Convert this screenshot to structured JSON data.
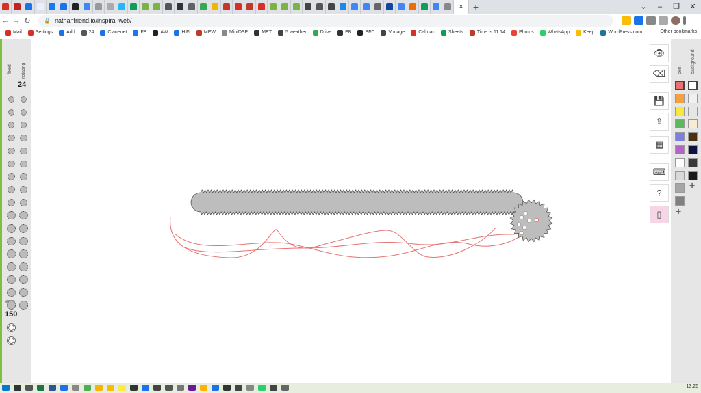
{
  "browser": {
    "url": "nathanfriend.io/inspiral-web/",
    "tab_count": 48,
    "close_label": "×",
    "new_tab_label": "+",
    "window_controls": [
      "⌄",
      "–",
      "❐",
      "✕"
    ],
    "bookmarks": [
      {
        "label": "Mail",
        "color": "#d93025"
      },
      {
        "label": "Settings",
        "color": "#d93025"
      },
      {
        "label": "Add",
        "color": "#1a73e8"
      },
      {
        "label": "24",
        "color": "#555555"
      },
      {
        "label": "Clanenet",
        "color": "#1a73e8"
      },
      {
        "label": "FB",
        "color": "#1877f2"
      },
      {
        "label": "AW",
        "color": "#222222"
      },
      {
        "label": "HiFi",
        "color": "#1a73e8"
      },
      {
        "label": "MEW",
        "color": "#c0392b"
      },
      {
        "label": "MiniDSP",
        "color": "#888888"
      },
      {
        "label": "MET",
        "color": "#333333"
      },
      {
        "label": "5 weather",
        "color": "#444444"
      },
      {
        "label": "Drive",
        "color": "#34a853"
      },
      {
        "label": "EB",
        "color": "#333333"
      },
      {
        "label": "SFC",
        "color": "#222222"
      },
      {
        "label": "Vonage",
        "color": "#444444"
      },
      {
        "label": "Calmac",
        "color": "#d93025"
      },
      {
        "label": "Sheets",
        "color": "#0f9d58"
      },
      {
        "label": "Time.is 11:14",
        "color": "#c0392b"
      },
      {
        "label": "Photos",
        "color": "#ea4335"
      },
      {
        "label": "WhatsApp",
        "color": "#25d366"
      },
      {
        "label": "Keep",
        "color": "#fbbc04"
      },
      {
        "label": "WordPress.com",
        "color": "#21759b"
      }
    ],
    "other_bookmarks": "Other bookmarks"
  },
  "left_panel": {
    "fixed_label": "fixed",
    "rotating_label": "rotating",
    "selected_rotating_teeth": "24",
    "selected_fixed_teeth": "150",
    "fixed_gear_count": 17,
    "rotating_gear_count": 17,
    "extra_gear_count": 2
  },
  "right_panel": {
    "tools": [
      {
        "name": "eye-icon",
        "glyph": "👁"
      },
      {
        "name": "eraser-icon",
        "glyph": "⌫"
      },
      {
        "name": "save-icon",
        "glyph": "💾"
      },
      {
        "name": "upload-icon",
        "glyph": "⇪"
      },
      {
        "name": "grid-icon",
        "glyph": "▦"
      },
      {
        "name": "keyboard-icon",
        "glyph": "⌨"
      },
      {
        "name": "help-icon",
        "glyph": "?"
      },
      {
        "name": "phone-icon",
        "glyph": "▯"
      }
    ],
    "pen_label": "pen",
    "background_label": "background",
    "pen_colors": [
      "#e57373",
      "#f4a142",
      "#f4e842",
      "#5cb85c",
      "#7b7fdf",
      "#b266c4",
      "#ffffff",
      "#d9d9d9",
      "#a6a6a6",
      "#808080"
    ],
    "background_colors": [
      "#ffffff",
      "#f0f0f0",
      "#e6e6e6",
      "#f6ecd4",
      "#4a3210",
      "#0d1340",
      "#3a3a3a",
      "#1a1a1a"
    ],
    "selected_pen": "#e57373",
    "selected_background": "#ffffff",
    "add_label": "+"
  },
  "canvas": {
    "fixed_gear_fill": "#bdbdbd",
    "gear_stroke": "#555555",
    "trace_color": "#e57373"
  },
  "taskbar": {
    "clock": "13:26"
  }
}
